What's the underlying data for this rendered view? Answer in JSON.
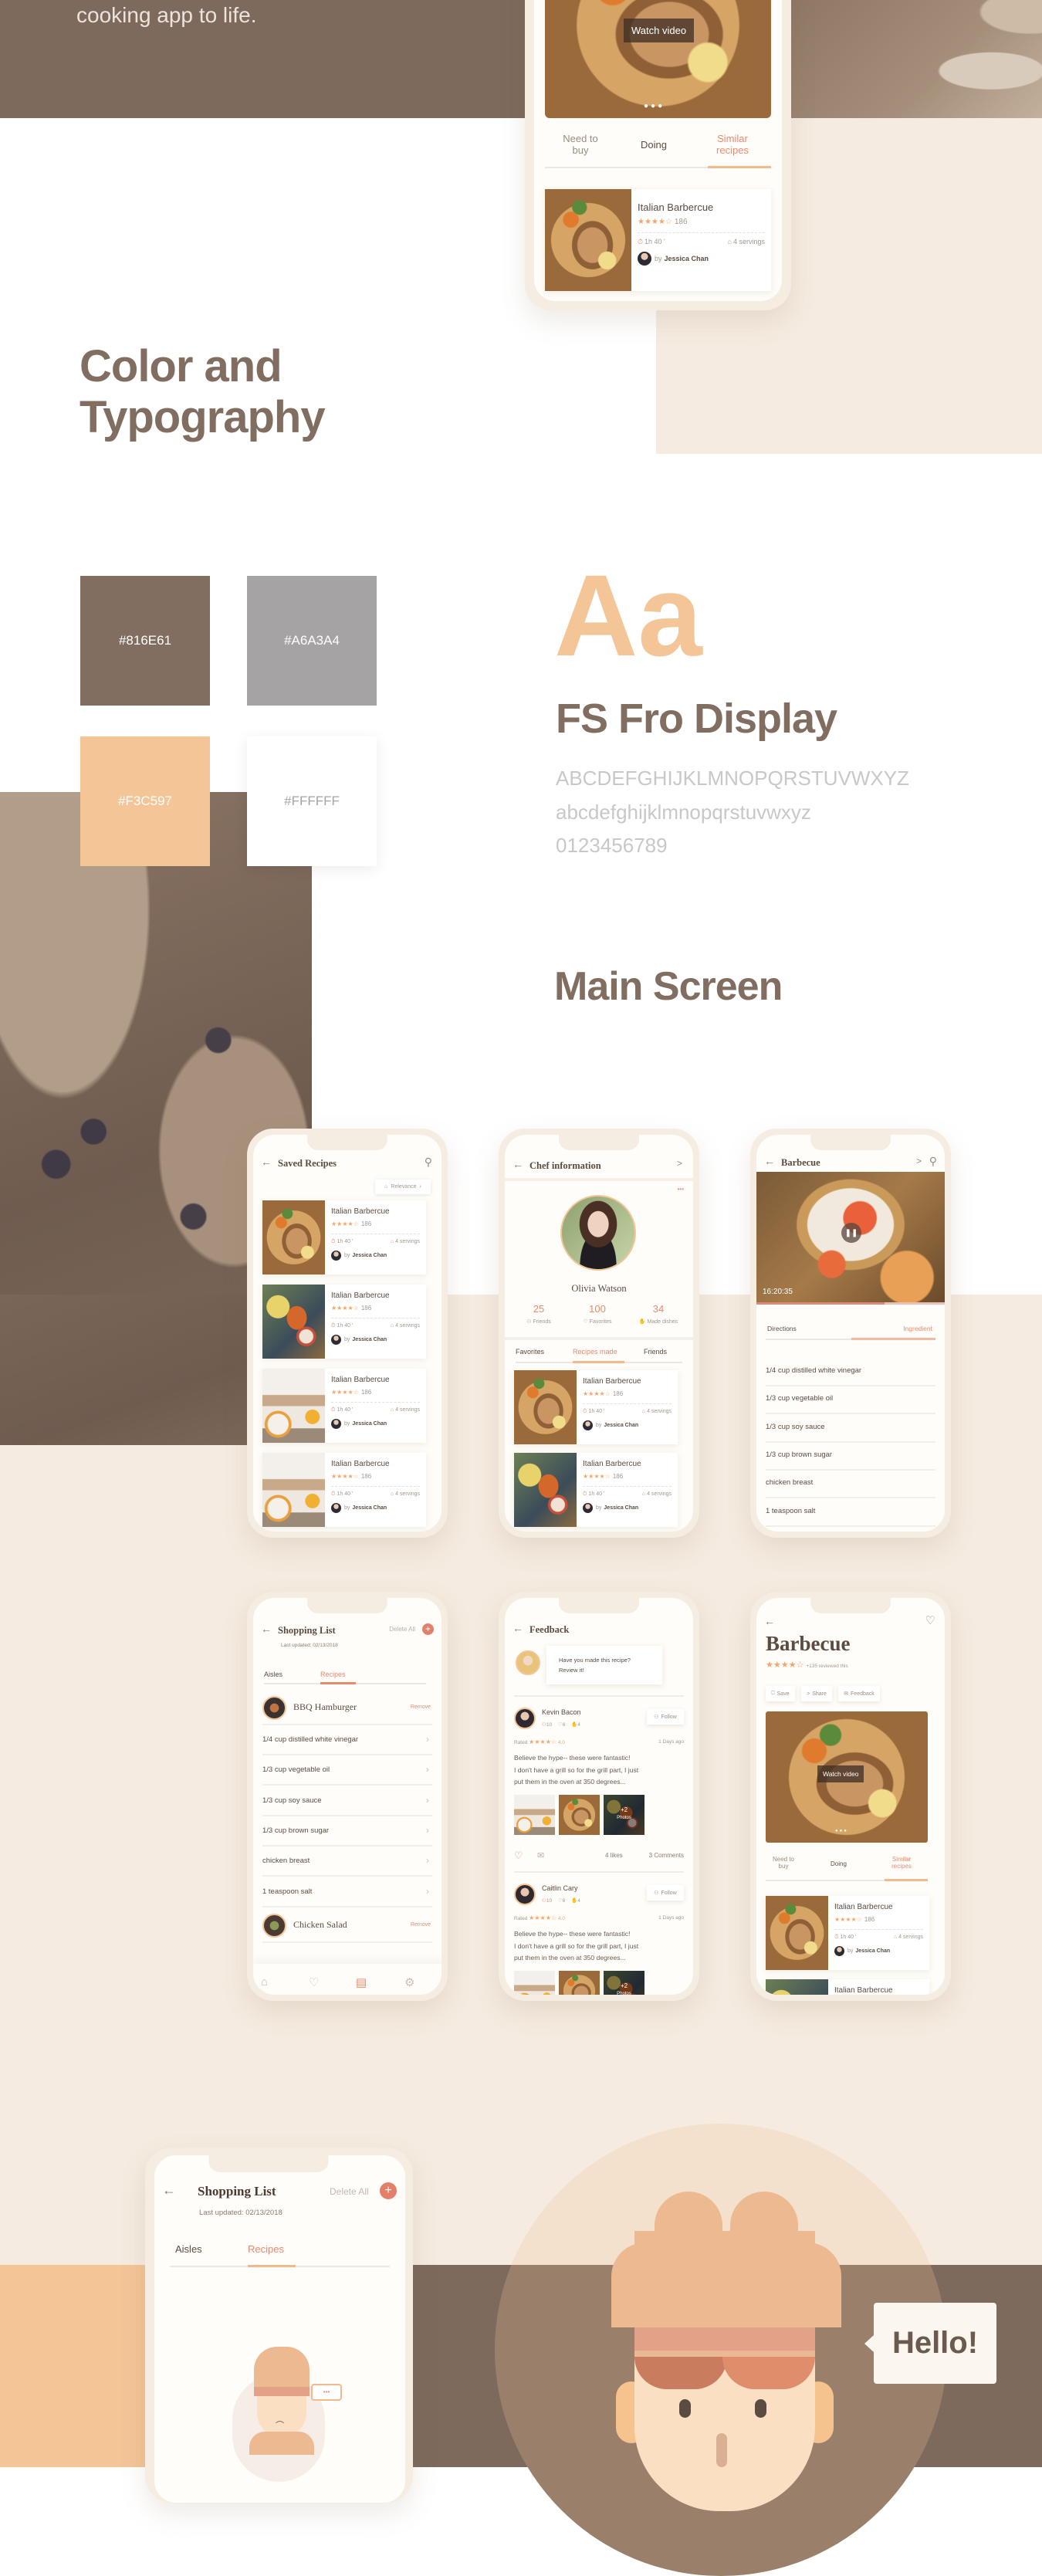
{
  "hero": {
    "tagline_tail": "cooking app to life."
  },
  "colors": {
    "brown": "#816E61",
    "grey": "#A6A3A4",
    "peach": "#F3C597",
    "white": "#FFFFFF",
    "beige": "#F5EBE0",
    "accent": "#E98A6E"
  },
  "section_color": {
    "title_line1": "Color and",
    "title_line2": "Typography"
  },
  "swatches": [
    {
      "hex": "#816E61"
    },
    {
      "hex": "#A6A3A4"
    },
    {
      "hex": "#F3C597"
    },
    {
      "hex": "#FFFFFF"
    }
  ],
  "typography": {
    "sample": "Aa",
    "font_name": "FS Fro Display",
    "uppercase": "ABCDEFGHIJKLMNOPQRSTUVWXYZ",
    "lowercase": "abcdefghijklmnopqrstuvwxyz",
    "digits": "0123456789"
  },
  "section_main": {
    "title": "Main Screen"
  },
  "recipe_card": {
    "title": "Italian Barbercue",
    "stars": "★★★★☆",
    "rating_count": "186",
    "time": "1h 40 '",
    "servings": "4 servings",
    "by": "by",
    "author": "Jessica Chan"
  },
  "top_phone": {
    "watch_video": "Watch video",
    "tabs": [
      "Need to buy",
      "Doing",
      "Similar recipes"
    ],
    "active_tab": 2
  },
  "saved_recipes": {
    "title": "Saved Recipes",
    "sort_label": "Relevance",
    "cards": [
      {
        "image": "grilled-chicken"
      },
      {
        "image": "skewers"
      },
      {
        "image": "breakfast"
      },
      {
        "image": "breakfast"
      }
    ]
  },
  "chef": {
    "title": "Chef information",
    "more": "•••",
    "name": "Olivia Watson",
    "stats": [
      {
        "value": "25",
        "label": "Friends"
      },
      {
        "value": "100",
        "label": "Favorites"
      },
      {
        "value": "34",
        "label": "Made dishes"
      }
    ],
    "tabs": [
      "Favorites",
      "Recipes made",
      "Friends"
    ],
    "active_tab": 1,
    "cards": [
      {
        "image": "grilled-chicken"
      },
      {
        "image": "skewers"
      }
    ]
  },
  "barbecue_video": {
    "title": "Barbecue",
    "timestamp": "16:20:35",
    "progress": 0.68,
    "tabs": [
      "Directions",
      "Ingredient"
    ],
    "active_tab": 1,
    "ingredients": [
      "1/4 cup distilled white vinegar",
      "1/3 cup vegetable oil",
      "1/3 cup soy sauce",
      "1/3 cup brown sugar",
      "chicken breast",
      "1 teaspoon salt"
    ]
  },
  "shopping": {
    "title": "Shopping List",
    "delete_all": "Delete All",
    "add": "+",
    "last_updated": "Last updated: 02/13/2018",
    "tabs": [
      "Aisles",
      "Recipes"
    ],
    "active_tab": 1,
    "remove": "Remove",
    "recipe1": "BBQ Hamburger",
    "recipe2": "Chicken Salad",
    "items": [
      "1/4 cup distilled white vinegar",
      "1/3 cup vegetable oil",
      "1/3 cup soy sauce",
      "1/3 cup brown sugar",
      "chicken breast",
      "1 teaspoon salt"
    ],
    "nav": [
      "home",
      "heart",
      "list",
      "settings"
    ],
    "active_nav": 2
  },
  "feedback": {
    "title": "Feedback",
    "prompt_line1": "Have you made this recipe?",
    "prompt_line2": "Review it!",
    "follow": "Follow",
    "rated": "Rated",
    "stars": "★★★★☆",
    "score": "4.0",
    "ago": "1 Days ago",
    "stat_friends": "10",
    "stat_favs": "6",
    "stat_made": "4",
    "text_lines": [
      "Believe the hype-- these were fantastic!",
      "I don't have a grill so for the grill part, I just",
      "put them in the oven at 350 degrees..."
    ],
    "more_photos": "+2",
    "photos_label": "Photos",
    "likes": "4 likes",
    "comments": "3 Comments",
    "reviewers": [
      "Kevin Bacon",
      "Caitlin Cary"
    ]
  },
  "barbecue_detail": {
    "title": "Barbecue",
    "stars": "★★★★☆",
    "reviewed": "+135 reviewed this",
    "actions": [
      "Save",
      "Share",
      "Feedback"
    ],
    "watch_video": "Watch video",
    "tabs": [
      "Need to buy",
      "Doing",
      "Similar recipes"
    ],
    "active_tab": 2
  },
  "bottom_phone": {
    "title": "Shopping List",
    "delete_all": "Delete All",
    "add": "+",
    "last_updated": "Last updated: 02/13/2018",
    "tabs": [
      "Aisles",
      "Recipes"
    ],
    "active_tab": 1,
    "bubble": "•••"
  },
  "hello": {
    "text": "Hello!"
  }
}
